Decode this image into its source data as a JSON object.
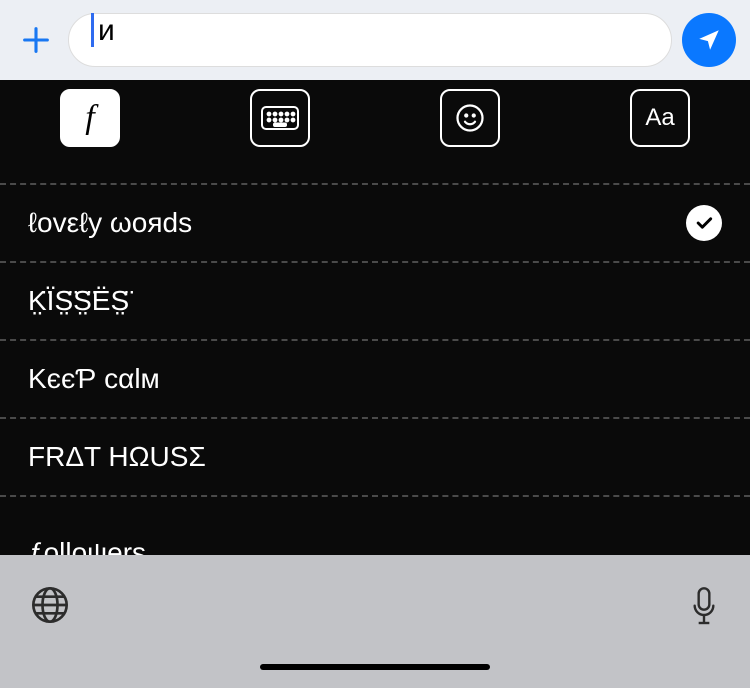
{
  "input": {
    "value": "и"
  },
  "toolbar": {
    "tabs": [
      {
        "id": "font-style-tab",
        "label": "f",
        "active": true
      },
      {
        "id": "keyboard-tab",
        "label": "",
        "active": false,
        "icon": "keyboard"
      },
      {
        "id": "emoji-tab",
        "label": "",
        "active": false,
        "icon": "smile"
      },
      {
        "id": "text-size-tab",
        "label": "Aa",
        "active": false
      }
    ]
  },
  "fonts": [
    {
      "label": "ℓovεℓy ωoяds",
      "selected": true
    },
    {
      "label": "K̤̈ÏS̤̈S̤̈ËS̤̈",
      "selected": false
    },
    {
      "label": "KєєƤ cαlм",
      "selected": false
    },
    {
      "label": "FRΔT HΩUSΣ",
      "selected": false
    },
    {
      "label": "ƒolloψers",
      "selected": false
    }
  ]
}
